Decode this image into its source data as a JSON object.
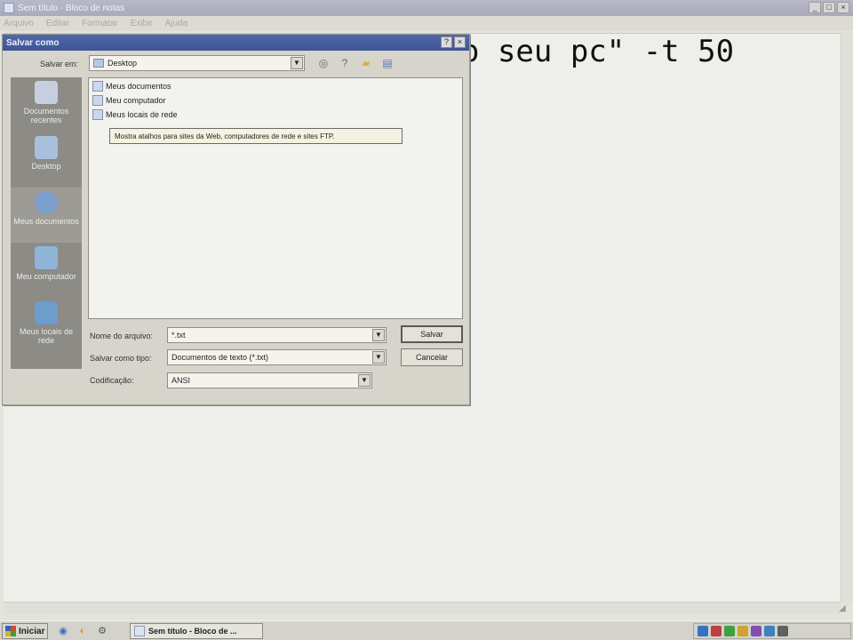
{
  "notepad": {
    "title": "Sem título - Bloco de notas",
    "menu": [
      "Arquivo",
      "Editar",
      "Formatar",
      "Exibir",
      "Ajuda"
    ],
    "content": "o seu pc\" -t 50"
  },
  "dialog": {
    "title": "Salvar como",
    "look_in_label": "Salvar em:",
    "look_in_value": "Desktop",
    "places": [
      {
        "label": "Documentos recentes"
      },
      {
        "label": "Desktop"
      },
      {
        "label": "Meus documentos"
      },
      {
        "label": "Meu computador"
      },
      {
        "label": "Meus locais de rede"
      }
    ],
    "files": [
      {
        "name": "Meus documentos"
      },
      {
        "name": "Meu computador"
      },
      {
        "name": "Meus locais de rede"
      }
    ],
    "tooltip": "Mostra atalhos para sites da Web, computadores de rede e sites FTP.",
    "filename_label": "Nome do arquivo:",
    "filename_value": "*.txt",
    "filetype_label": "Salvar como tipo:",
    "filetype_value": "Documentos de texto (*.txt)",
    "encoding_label": "Codificação:",
    "encoding_value": "ANSI",
    "save_button": "Salvar",
    "cancel_button": "Cancelar"
  },
  "taskbar": {
    "start_label": "Iniciar",
    "task_label": "Sem título - Bloco de ..."
  },
  "colors": {
    "dialog_title": "#4a62a2",
    "window_bg": "#d6d4cb",
    "places_bar": "#8c8b86",
    "tooltip_bg": "#f4f3e1"
  }
}
